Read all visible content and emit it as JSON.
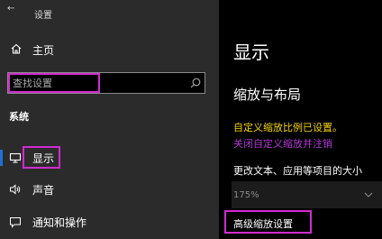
{
  "titlebar": {
    "back_icon": "back-arrow-icon",
    "title": "设置"
  },
  "sidebar": {
    "home_label": "主页",
    "search_placeholder": "查找设置",
    "section_heading": "系统",
    "items": [
      {
        "label": "显示",
        "icon": "monitor-icon",
        "active": true
      },
      {
        "label": "声音",
        "icon": "speaker-icon",
        "active": false
      },
      {
        "label": "通知和操作",
        "icon": "notification-icon",
        "active": false
      }
    ]
  },
  "main": {
    "page_title": "显示",
    "section_title": "缩放与布局",
    "warning": "自定义缩放比例已设置。",
    "signout_link": "关闭自定义缩放并注销",
    "scale_label": "更改文本、应用等项目的大小",
    "scale_value": "175%",
    "advanced_link": "高级缩放设置"
  },
  "colors": {
    "sidebar_bg": "#2b2b2b",
    "main_bg": "#000000",
    "warning": "#f5d400",
    "link": "#b13ad8",
    "highlight": "#d12bd1",
    "accent": "#1f6fd6"
  }
}
